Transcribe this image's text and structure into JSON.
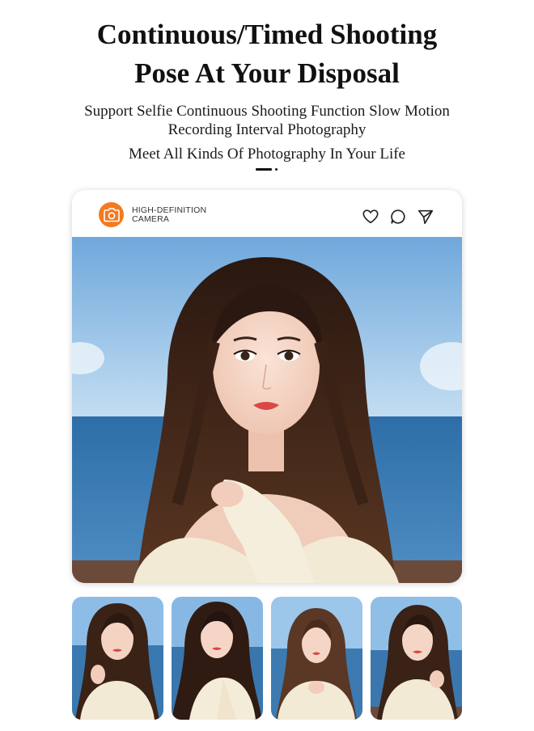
{
  "headline": {
    "line1": "Continuous/Timed Shooting",
    "line2": "Pose At Your Disposal"
  },
  "subtitle": {
    "line1": "Support Selfie Continuous Shooting Function Slow Motion",
    "line2": "Recording Interval Photography",
    "line3": "Meet All Kinds Of Photography In Your Life"
  },
  "card": {
    "brand_line1": "HIGH-DEFINITION",
    "brand_line2": "CAMERA",
    "icons": [
      "camera-icon",
      "heart-icon",
      "comment-icon",
      "send-icon"
    ]
  },
  "colors": {
    "accent": "#f47a1f",
    "sky": "#8cc0e8",
    "sea": "#2f6fa6",
    "hair": "#3a2318",
    "sweater": "#f3ead6",
    "skin": "#f2d3c3",
    "lips": "#d94845"
  },
  "thumbnails": [
    "portrait-1",
    "portrait-2",
    "portrait-3",
    "portrait-4"
  ]
}
